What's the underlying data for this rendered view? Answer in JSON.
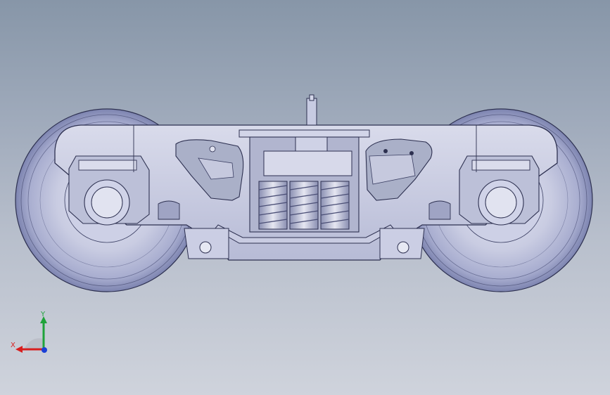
{
  "viewport": {
    "model": "bogie-assembly",
    "view": "front"
  },
  "triad": {
    "x_label": "X",
    "y_label": "Y",
    "colors": {
      "x": "#d81e1e",
      "y": "#1fa33a",
      "z": "#1b3fd6"
    }
  }
}
